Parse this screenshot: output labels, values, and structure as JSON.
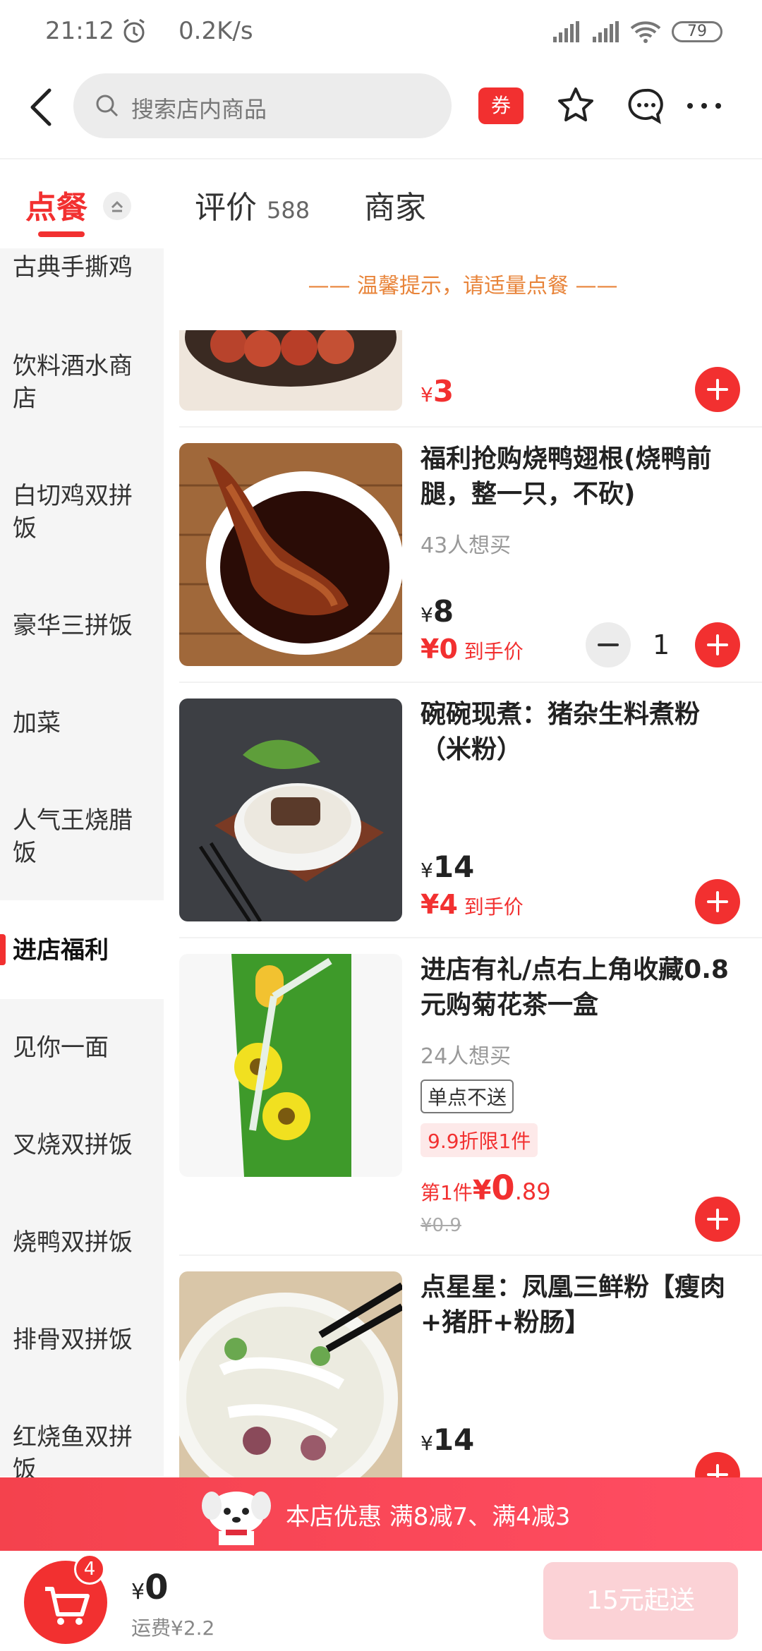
{
  "status_bar": {
    "time": "21:12",
    "speed": "0.2K/s",
    "battery": "79"
  },
  "header": {
    "search_placeholder": "搜索店内商品",
    "coupon_label": "券"
  },
  "tabs": {
    "order": "点餐",
    "reviews": "评价",
    "reviews_count": "588",
    "merchant": "商家"
  },
  "sidebar": {
    "items": [
      "古典手撕鸡",
      "饮料酒水商店",
      "白切鸡双拼饭",
      "豪华三拼饭",
      "加菜",
      "人气王烧腊饭",
      "进店福利",
      "见你一面",
      "叉烧双拼饭",
      "烧鸭双拼饭",
      "排骨双拼饭",
      "红烧鱼双拼饭"
    ]
  },
  "tip": "—— 温馨提示，请适量点餐 ——",
  "items": [
    {
      "price": "3",
      "currency": "¥"
    },
    {
      "title": "福利抢购烧鸭翅根(烧鸭前腿，整一只，不砍)",
      "want": "43人想买",
      "price": "8",
      "currency": "¥",
      "hand_price": "¥0",
      "hand_label": "到手价",
      "qty": "1"
    },
    {
      "title": "碗碗现煮：猪杂生料煮粉（米粉）",
      "price": "14",
      "currency": "¥",
      "hand_price": "¥4",
      "hand_label": "到手价"
    },
    {
      "title": "进店有礼/点右上角收藏0.8元购菊花茶一盒",
      "want": "24人想买",
      "tag1": "单点不送",
      "tag2": "9.9折限1件",
      "first_label": "第1件",
      "first_currency": "¥",
      "first_price_int": "0",
      "first_price_dec": ".89",
      "orig_price": "¥0.9"
    },
    {
      "title": "点星星：凤凰三鲜粉【瘦肉+猪肝+粉肠】",
      "price": "14",
      "currency": "¥"
    }
  ],
  "promo": {
    "text": "本店优惠  满8减7、满4减3"
  },
  "cart": {
    "badge": "4",
    "currency": "¥",
    "total": "0",
    "fee": "运费¥2.2",
    "checkout": "15元起送"
  }
}
